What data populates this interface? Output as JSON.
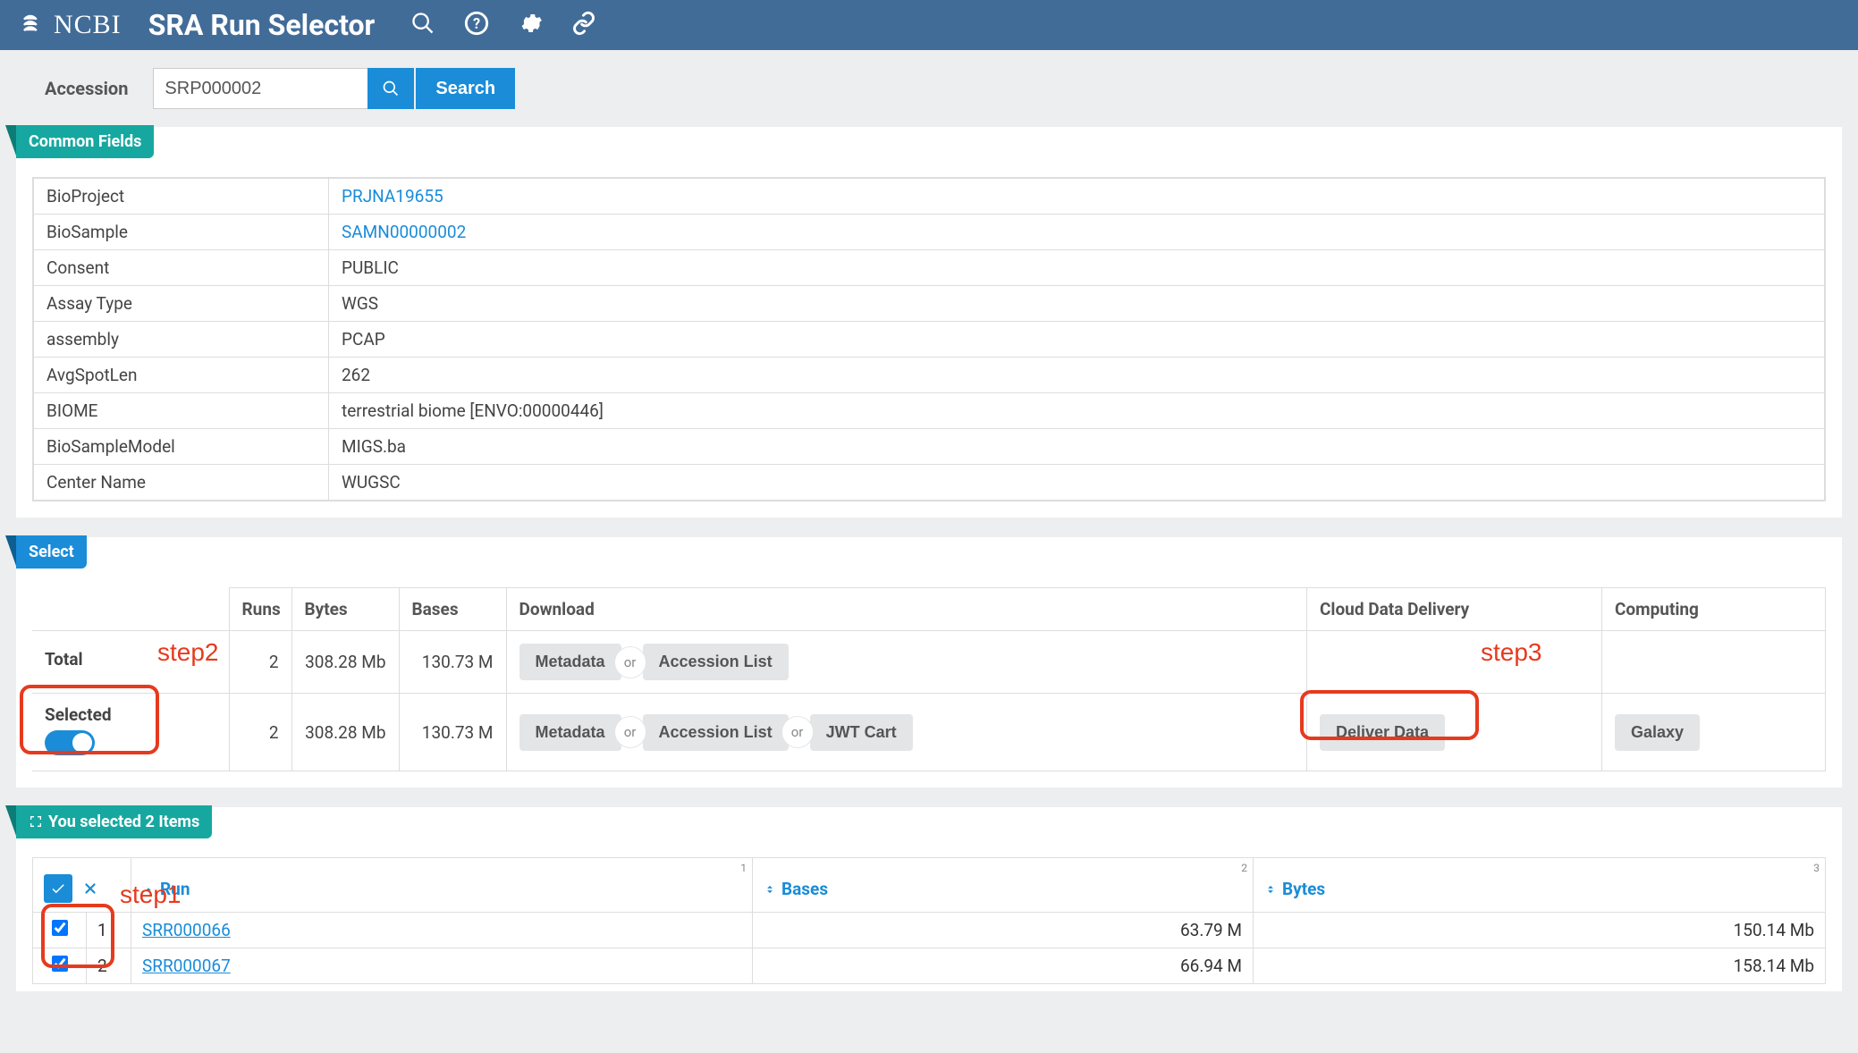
{
  "brand": "NCBI",
  "app_title": "SRA Run Selector",
  "accession": {
    "label": "Accession",
    "value": "SRP000002",
    "search_label": "Search"
  },
  "common_fields": {
    "tab": "Common Fields",
    "rows": [
      {
        "k": "BioProject",
        "v": "PRJNA19655",
        "link": true
      },
      {
        "k": "BioSample",
        "v": "SAMN00000002",
        "link": true
      },
      {
        "k": "Consent",
        "v": "PUBLIC",
        "link": false
      },
      {
        "k": "Assay Type",
        "v": "WGS",
        "link": false
      },
      {
        "k": "assembly",
        "v": "PCAP",
        "link": false
      },
      {
        "k": "AvgSpotLen",
        "v": "262",
        "link": false
      },
      {
        "k": "BIOME",
        "v": "terrestrial biome [ENVO:00000446]",
        "link": false
      },
      {
        "k": "BioSampleModel",
        "v": "MIGS.ba",
        "link": false
      },
      {
        "k": "Center Name",
        "v": "WUGSC",
        "link": false
      }
    ]
  },
  "select": {
    "tab": "Select",
    "headers": {
      "runs": "Runs",
      "bytes": "Bytes",
      "bases": "Bases",
      "download": "Download",
      "cloud": "Cloud Data Delivery",
      "compute": "Computing"
    },
    "total_label": "Total",
    "selected_label": "Selected",
    "total": {
      "runs": "2",
      "bytes": "308.28 Mb",
      "bases": "130.73 M"
    },
    "selected": {
      "runs": "2",
      "bytes": "308.28 Mb",
      "bases": "130.73 M"
    },
    "buttons": {
      "metadata": "Metadata",
      "or": "or",
      "accession_list": "Accession List",
      "jwt": "JWT Cart",
      "deliver": "Deliver Data",
      "galaxy": "Galaxy"
    }
  },
  "runs": {
    "tab": "You selected 2 Items",
    "headers": {
      "run": "Run",
      "bases": "Bases",
      "bytes": "Bytes"
    },
    "colnums": {
      "run": "1",
      "bases": "2",
      "bytes": "3"
    },
    "rows": [
      {
        "idx": "1",
        "run": "SRR000066",
        "bases": "63.79 M",
        "bytes": "150.14 Mb"
      },
      {
        "idx": "2",
        "run": "SRR000067",
        "bases": "66.94 M",
        "bytes": "158.14 Mb"
      }
    ]
  },
  "annotations": {
    "step1": "step1",
    "step2": "step2",
    "step3": "step3"
  }
}
